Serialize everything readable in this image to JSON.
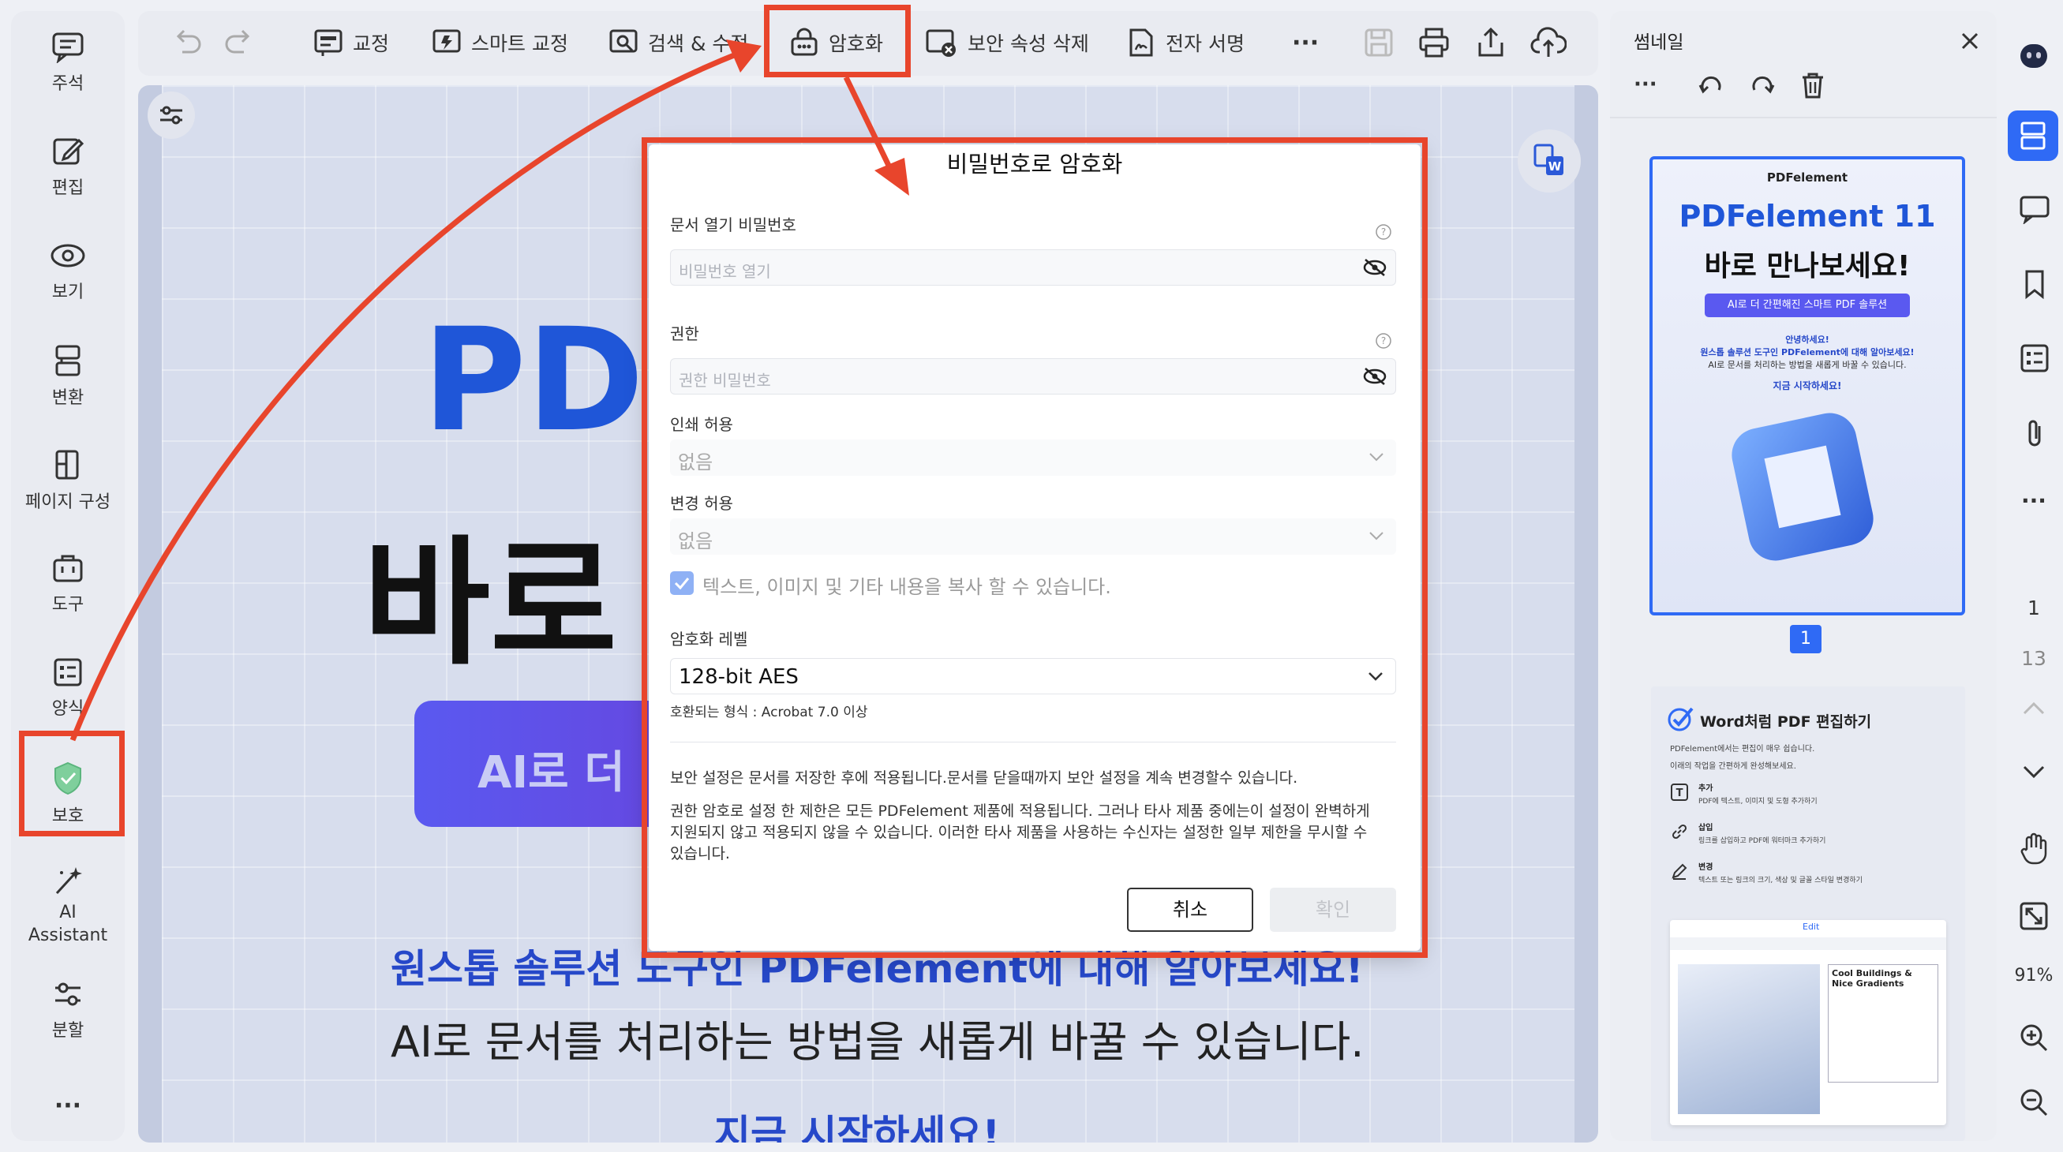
{
  "sidebar": {
    "items": [
      {
        "label": "주석",
        "icon": "comment-icon"
      },
      {
        "label": "편집",
        "icon": "edit-icon"
      },
      {
        "label": "보기",
        "icon": "eye-icon"
      },
      {
        "label": "변환",
        "icon": "convert-icon"
      },
      {
        "label": "페이지 구성",
        "icon": "page-organize-icon"
      },
      {
        "label": "도구",
        "icon": "toolbox-icon"
      },
      {
        "label": "양식",
        "icon": "form-icon"
      },
      {
        "label": "보호",
        "icon": "shield-icon"
      },
      {
        "label": "AI",
        "label2": "Assistant",
        "icon": "ai-wand-icon"
      },
      {
        "label": "분할",
        "icon": "split-icon"
      }
    ],
    "more": "···"
  },
  "toolbar": {
    "items": [
      {
        "label": "교정",
        "icon": "proofread-icon"
      },
      {
        "label": "스마트 교정",
        "icon": "smart-redact-icon"
      },
      {
        "label": "검색 & 수정",
        "icon": "search-edit-icon"
      },
      {
        "label": "암호화",
        "icon": "lock-icon"
      },
      {
        "label": "보안 속성 삭제",
        "icon": "remove-security-icon"
      },
      {
        "label": "전자 서명",
        "icon": "e-sign-icon"
      }
    ],
    "more": "···"
  },
  "document": {
    "title_part1": "PDF",
    "title_part2": "바로",
    "button_text": "AI로 더",
    "line1": "원스톱 솔루션 도구인 PDFelement에 대해 알아보세요!",
    "line2": "AI로 문서를 처리하는 방법을 새롭게 바꿀 수 있습니다.",
    "line3": "지금 시작하세요!"
  },
  "modal": {
    "title": "비밀번호로 암호화",
    "open_password_label": "문서 열기 비밀번호",
    "open_password_placeholder": "비밀번호 열기",
    "permission_label": "권한",
    "permission_placeholder": "권한 비밀번호",
    "print_label": "인쇄 허용",
    "print_value": "없음",
    "change_label": "변경 허용",
    "change_value": "없음",
    "copy_checkbox_label": "텍스트, 이미지 및 기타 내용을 복사 할 수 있습니다.",
    "copy_checked": true,
    "encrypt_level_label": "암호화 레벨",
    "encrypt_level_value": "128-bit AES",
    "compat_text": "호환되는 형식 : Acrobat 7.0 이상",
    "note1": "보안 설정은 문서를 저장한 후에 적용됩니다.문서를 닫을때까지 보안 설정을 계속 변경할수 있습니다.",
    "note2": "권한 암호로 설정 한 제한은 모든 PDFelement 제품에 적용됩니다. 그러나 타사 제품 중에는이 설정이 완벽하게 지원되지 않고 적용되지 않을 수 있습니다. 이러한 타사 제품을 사용하는 수신자는 설정한 일부 제한을 무시할 수 있습니다.",
    "cancel_label": "취소",
    "confirm_label": "확인"
  },
  "thumbnails": {
    "title": "썸네일",
    "page1_brand": "PDFelement",
    "page1_heading": "PDFelement 11",
    "page1_sub": "바로 만나보세요!",
    "page1_pill": "AI로 더 간편해진 스마트 PDF 솔루션",
    "page1_text1": "안녕하세요!",
    "page1_text2": "원스톱 솔루션 도구인 PDFelement에 대해 알아보세요!",
    "page1_text3": "AI로 문서를 처리하는 방법을 새롭게 바꿀 수 있습니다.",
    "page1_text4": "지금 시작하세요!",
    "page1_number": "1",
    "page2_heading": "Word처럼 PDF 편집하기",
    "page2_intro1": "PDFelement에서는 편집이 매우 쉽습니다.",
    "page2_intro2": "이래의 작업을 간편하게 완성해보세요.",
    "page2_item1_title": "추가",
    "page2_item1_desc": "PDF에 텍스트, 이미지 및 도형 추가하기",
    "page2_item2_title": "삽입",
    "page2_item2_desc": "링크를 삽입하고 PDF에 워터마크 추가하기",
    "page2_item3_title": "변경",
    "page2_item3_desc": "텍스트 또는 링크의 크기, 색상 및 글꼴 스타일 변경하기",
    "page2_edit_tab": "Edit",
    "page2_card": "Cool Buildings & Nice Gradients"
  },
  "rightbar": {
    "current_page": "1",
    "total_pages": "13",
    "zoom": "91%"
  },
  "colors": {
    "accent_red": "#e8452c",
    "brand_blue": "#1f56d8",
    "selected_blue": "#2f6af5"
  }
}
